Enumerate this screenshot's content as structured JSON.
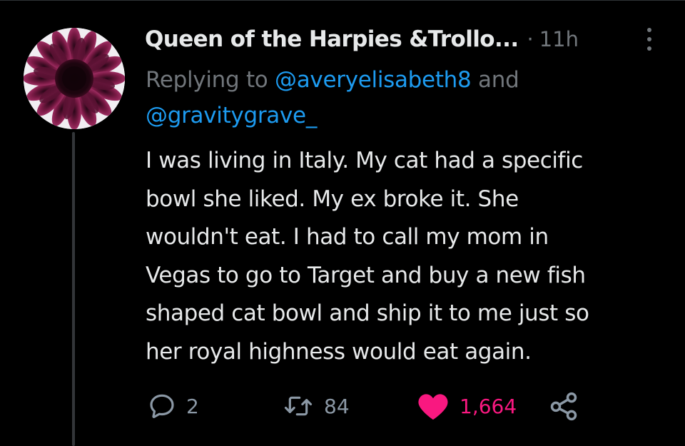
{
  "tweet": {
    "display_name": "Queen of the Harpies &Trollo...",
    "separator": "·",
    "time": "11h",
    "reply": {
      "prefix": "Replying to ",
      "mention_1": "@averyelisabeth8",
      "joiner": " and",
      "mention_2": "@gravitygrave_"
    },
    "body_lines": [
      "I was living in Italy. My cat had a specific",
      "bowl she liked. My ex broke it. She",
      "wouldn't eat. I had to call my mom in",
      "Vegas to go to Target and buy a new fish",
      "shaped cat bowl and ship it to me just so",
      "her royal highness would eat again."
    ],
    "actions": {
      "replies": "2",
      "retweets": "84",
      "likes": "1,664"
    },
    "icons": {
      "reply": "reply-bubble-icon",
      "retweet": "retweet-icon",
      "like": "heart-filled-icon",
      "share": "share-icon",
      "more": "more-vertical-icon"
    },
    "colors": {
      "background": "#000000",
      "text": "#e7e9ea",
      "muted": "#71767b",
      "link": "#1d9bf0",
      "like": "#f91880"
    }
  }
}
